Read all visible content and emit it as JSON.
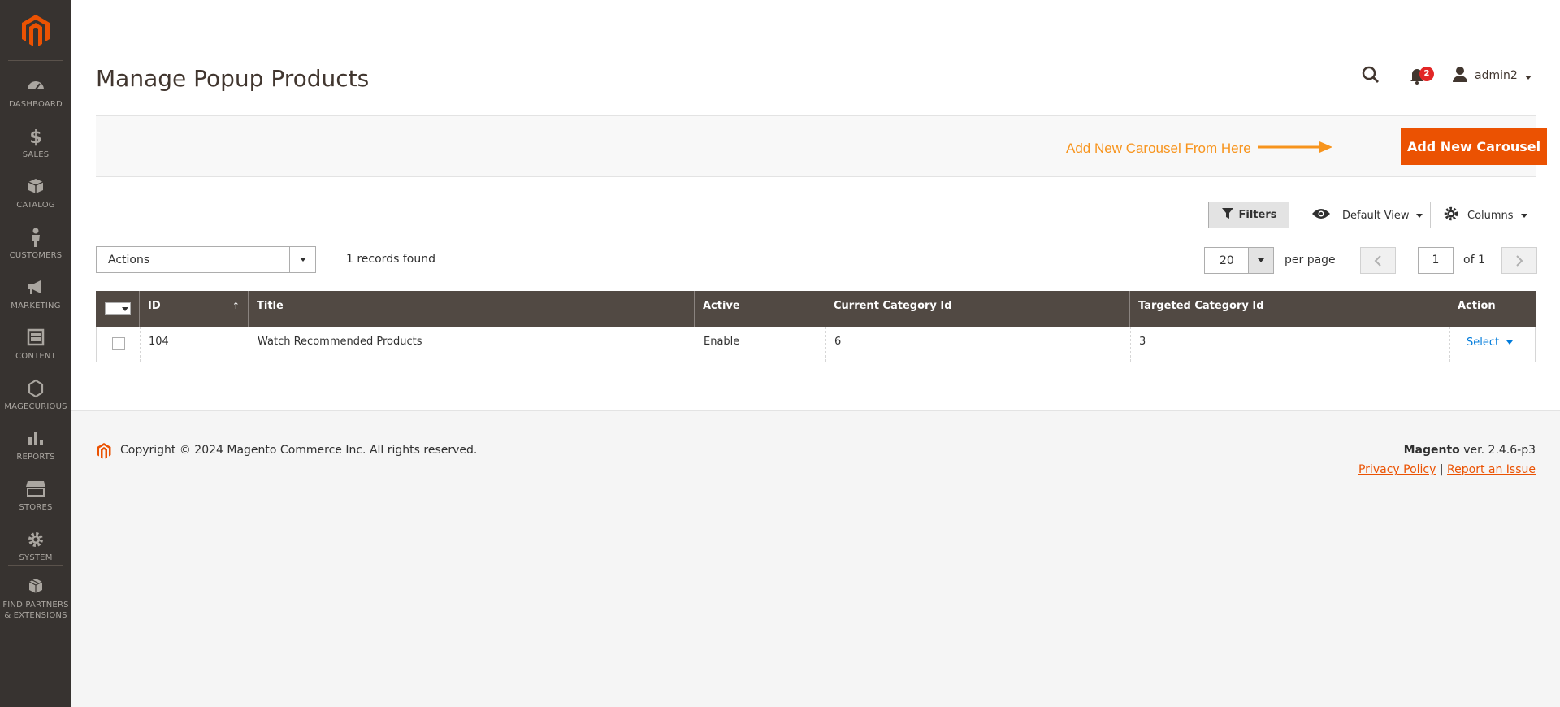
{
  "sidebar": {
    "items": [
      {
        "label": "DASHBOARD",
        "icon": "dashboard-icon"
      },
      {
        "label": "SALES",
        "icon": "dollar-icon"
      },
      {
        "label": "CATALOG",
        "icon": "box-icon"
      },
      {
        "label": "CUSTOMERS",
        "icon": "person-icon"
      },
      {
        "label": "MARKETING",
        "icon": "megaphone-icon"
      },
      {
        "label": "CONTENT",
        "icon": "layout-icon"
      },
      {
        "label": "MAGECURIOUS",
        "icon": "hexagon-icon"
      },
      {
        "label": "REPORTS",
        "icon": "bar-chart-icon"
      },
      {
        "label": "STORES",
        "icon": "store-icon"
      },
      {
        "label": "SYSTEM",
        "icon": "gear-icon"
      },
      {
        "label_line1": "FIND PARTNERS",
        "label_line2": "& EXTENSIONS",
        "icon": "cubes-icon"
      }
    ]
  },
  "header": {
    "title": "Manage Popup Products",
    "notification_count": "2",
    "user": "admin2"
  },
  "page_actions": {
    "hint": "Add New Carousel From Here",
    "add_button": "Add New Carousel"
  },
  "toolbar": {
    "filters": "Filters",
    "view": "Default View",
    "columns": "Columns",
    "actions": "Actions",
    "records_found": "1 records found",
    "per_page_value": "20",
    "per_page_label": "per page",
    "page_value": "1",
    "page_of": "of 1"
  },
  "grid": {
    "columns": [
      "ID",
      "Title",
      "Active",
      "Current Category Id",
      "Targeted Category Id",
      "Action"
    ],
    "sort_indicator": "↑",
    "rows": [
      {
        "id": "104",
        "title": "Watch Recommended Products",
        "active": "Enable",
        "current_category_id": "6",
        "targeted_category_id": "3",
        "action": "Select"
      }
    ]
  },
  "footer": {
    "copyright": "Copyright © 2024 Magento Commerce Inc. All rights reserved.",
    "brand": "Magento",
    "version": " ver. 2.4.6-p3",
    "privacy_link": "Privacy Policy",
    "separator": " | ",
    "report_link": "Report an Issue"
  },
  "colors": {
    "sidebar_bg": "#373330",
    "accent": "#eb5202",
    "hint": "#f7941d",
    "table_header": "#514943",
    "link": "#007bdb"
  }
}
